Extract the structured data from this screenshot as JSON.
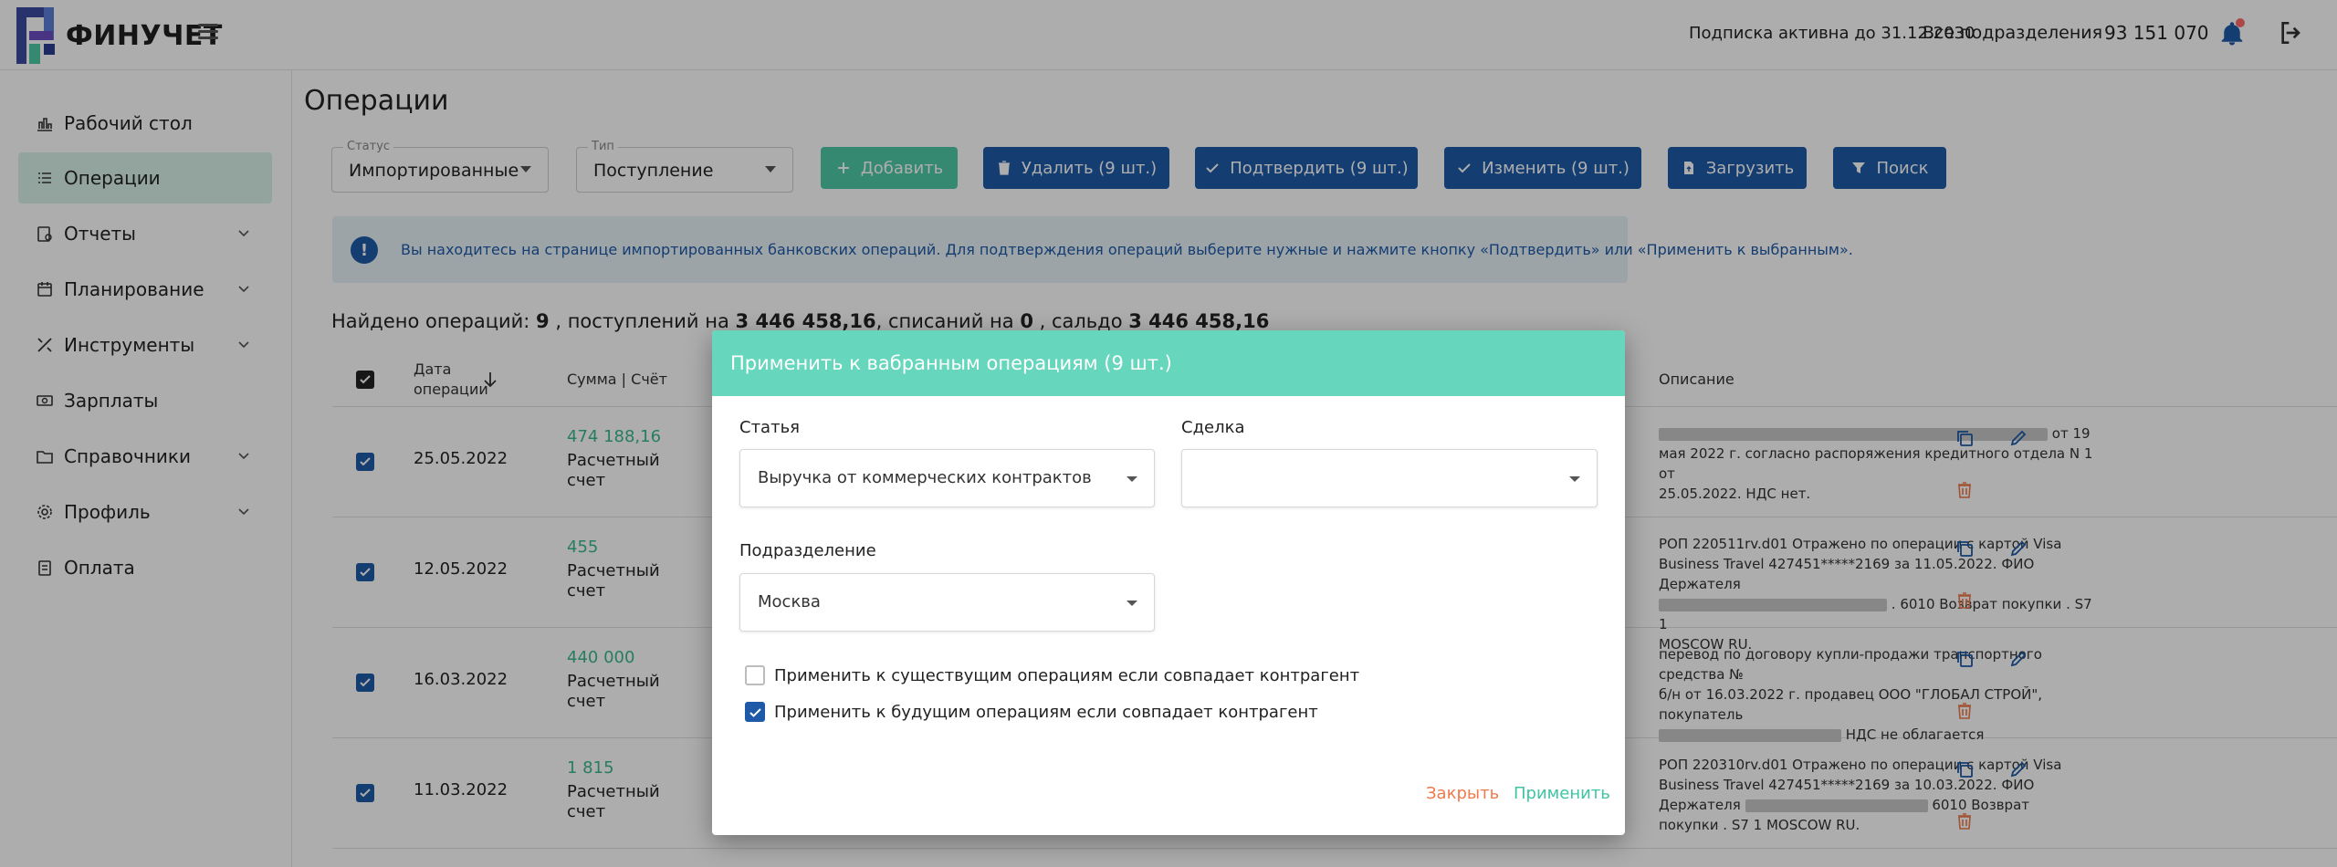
{
  "header": {
    "logo_text": "ФИНУЧЕТ",
    "subscription": "Подписка активна до 31.12.2030",
    "units": "Все подразделения",
    "balance": "93 151 070"
  },
  "sidebar": {
    "items": [
      {
        "label": "Рабочий стол"
      },
      {
        "label": "Операции"
      },
      {
        "label": "Отчеты"
      },
      {
        "label": "Планирование"
      },
      {
        "label": "Инструменты"
      },
      {
        "label": "Зарплаты"
      },
      {
        "label": "Справочники"
      },
      {
        "label": "Профиль"
      },
      {
        "label": "Оплата"
      }
    ]
  },
  "page": {
    "title": "Операции",
    "filters": {
      "status_label": "Статус",
      "status_value": "Импортированные",
      "type_label": "Тип",
      "type_value": "Поступление"
    },
    "buttons": {
      "add": "Добавить",
      "delete": "Удалить (9 шт.)",
      "confirm": "Подтвердить (9 шт.)",
      "change": "Изменить (9 шт.)",
      "upload": "Загрузить",
      "search": "Поиск"
    },
    "alert": "Вы находитесь на странице импортированных банковских операций. Для подтверждения операций выберите нужные и нажмите кнопку «Подтвердить» или «Применить к выбранным».",
    "summary": {
      "found_label": "Найдено операций: ",
      "found": "9",
      "income_label": " , поступлений на ",
      "income": "3 446 458,16",
      "expense_label": ", списаний на ",
      "expense": "0",
      "saldo_label": " , сальдо ",
      "saldo": "3 446 458,16"
    },
    "table": {
      "headers": {
        "date_line1": "Дата",
        "date_line2": "операции",
        "sum": "Сумма | Счёт",
        "description": "Описание"
      },
      "rows": [
        {
          "date": "25.05.2022",
          "amount": "474 188,16",
          "account": "Расчетный счет",
          "d1": "от 19",
          "d2": "мая 2022 г. согласно распоряжения кредитного отдела N 1 от",
          "d3": "25.05.2022. НДС нет."
        },
        {
          "date": "12.05.2022",
          "amount": "455",
          "account": "Расчетный счет",
          "d1": "РОП 220511rv.d01 Отражено по операции с картой Visa",
          "d2": "Business Travel 427451*****2169 за 11.05.2022. ФИО Держателя",
          "d3": ". 6010 Возврат покупки . S7 1",
          "d4": "MOSCOW RU."
        },
        {
          "date": "16.03.2022",
          "amount": "440 000",
          "account": "Расчетный счет",
          "d1": "перевод по договору купли-продажи транспортного средства №",
          "d2": "б/н от 16.03.2022 г. продавец ООО \"ГЛОБАЛ СТРОЙ\", покупатель",
          "d3": "НДС не облагается"
        },
        {
          "date": "11.03.2022",
          "amount": "1 815",
          "account": "Расчетный счет",
          "d1": "РОП 220310rv.d01 Отражено по операции с картой Visa",
          "d2": "Business Travel 427451*****2169 за 10.03.2022. ФИО",
          "d3": "Держателя",
          "d3b": "6010 Возврат",
          "d4": "покупки . S7 1 MOSCOW RU."
        }
      ]
    }
  },
  "modal": {
    "title": "Применить к вабранным операциям (9 шт.)",
    "article_label": "Статья",
    "article_value": "Выручка от коммерческих контрактов",
    "deal_label": "Сделка",
    "deal_value": "",
    "division_label": "Подразделение",
    "division_value": "Москва",
    "check_existing": "Применить к существущим операциям если совпадает контрагент",
    "check_existing_checked": false,
    "check_future": "Применить к будущим операциям если совпадает контрагент",
    "check_future_checked": true,
    "close": "Закрыть",
    "apply": "Применить"
  },
  "colors": {
    "brand_blue": "#1e5aa8",
    "accent_green": "#4fcaa6",
    "modal_header": "#66d7bd",
    "close_orange": "#f07a4a",
    "apply_teal": "#3fc4a4",
    "amount_green": "#3cb88b"
  }
}
